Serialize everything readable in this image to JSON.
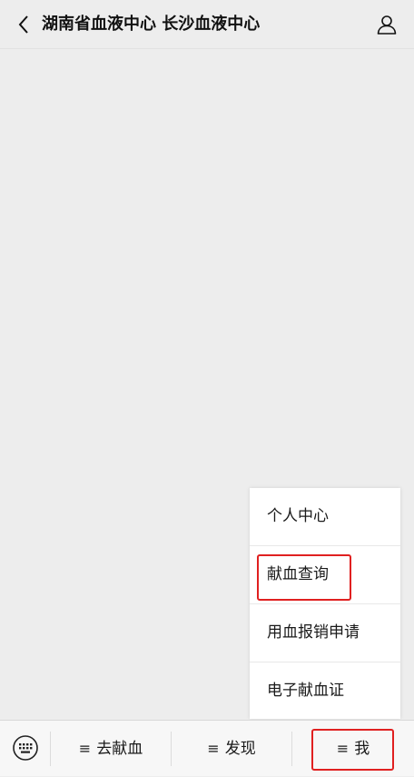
{
  "header": {
    "title": "湖南省血液中心 长沙血液中心",
    "back_icon": "chevron-left-icon",
    "profile_icon": "person-icon"
  },
  "popup_menu": {
    "items": [
      {
        "label": "个人中心"
      },
      {
        "label": "献血查询",
        "highlighted": true
      },
      {
        "label": "用血报销申请"
      },
      {
        "label": "电子献血证"
      }
    ]
  },
  "tabbar": {
    "keyboard_icon": "keyboard-icon",
    "menu_glyph": "≡",
    "tabs": [
      {
        "label": "去献血"
      },
      {
        "label": "发现"
      },
      {
        "label": "我",
        "highlighted": true
      }
    ]
  },
  "colors": {
    "background": "#ededed",
    "highlight": "#e02020",
    "text": "#1a1a1a"
  }
}
